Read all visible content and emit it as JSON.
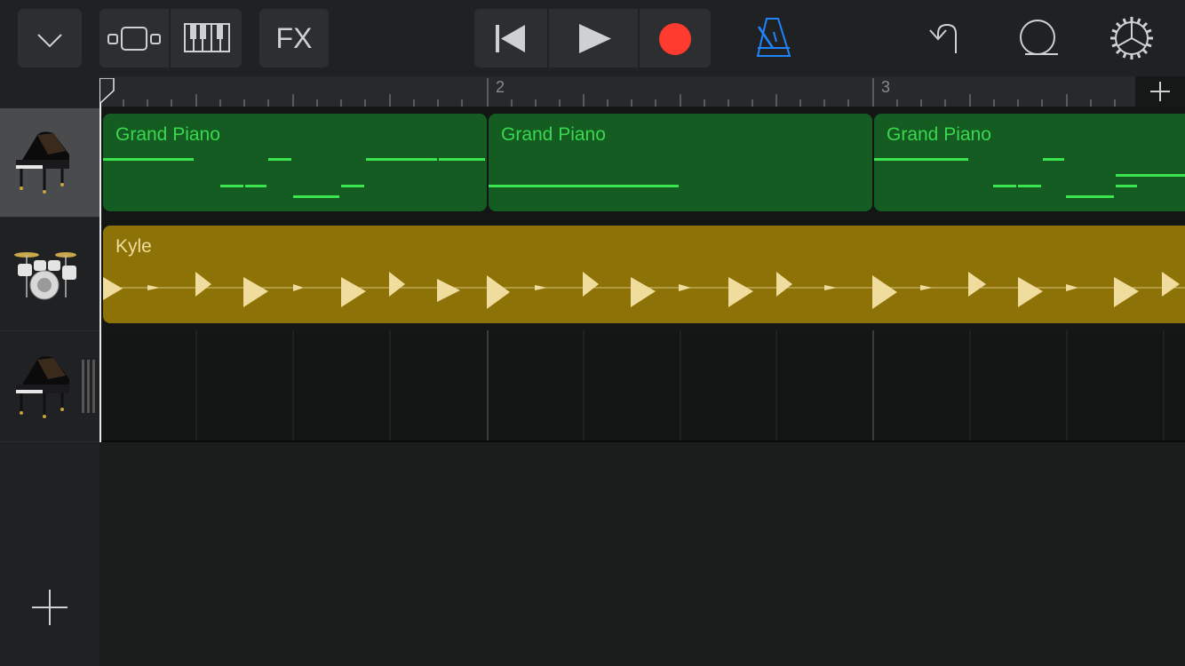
{
  "toolbar": {
    "fx_label": "FX",
    "accent_color": "#1f84ff",
    "record_color": "#ff3b30"
  },
  "ruler": {
    "bar2": "2",
    "bar3": "3"
  },
  "tracks": [
    {
      "instrument": "grand-piano",
      "selected": true
    },
    {
      "instrument": "drum-kit",
      "selected": false
    },
    {
      "instrument": "grand-piano",
      "selected": false
    }
  ],
  "regions": {
    "piano": [
      "Grand Piano",
      "Grand Piano",
      "Grand Piano"
    ],
    "drums": "Kyle"
  },
  "colors": {
    "piano_region": "#145c22",
    "drum_region": "#8c7207",
    "note": "#3be550"
  }
}
